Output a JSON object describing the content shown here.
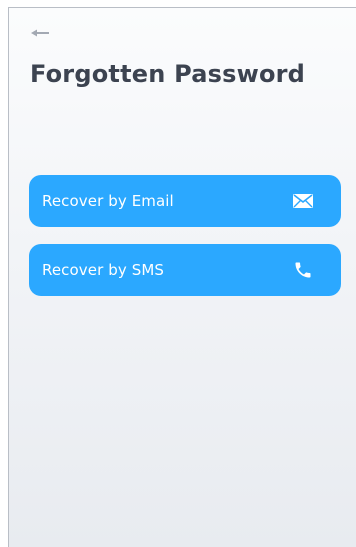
{
  "header": {
    "back_icon": "arrow-left-icon",
    "title": "Forgotten Password"
  },
  "options": [
    {
      "label": "Recover by Email",
      "icon": "envelope-icon"
    },
    {
      "label": "Recover by SMS",
      "icon": "phone-icon"
    }
  ],
  "colors": {
    "accent": "#2BA8FF",
    "title": "#3C4350",
    "back_icon": "#A3A9B3"
  }
}
